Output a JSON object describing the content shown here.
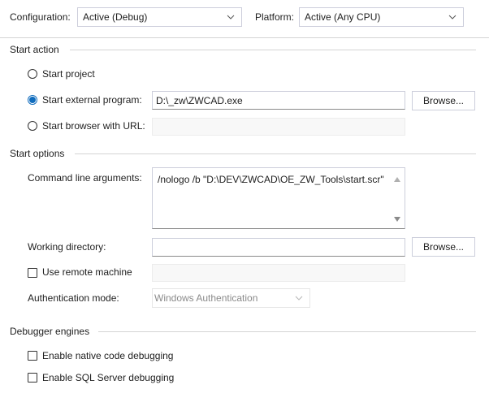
{
  "header": {
    "configuration_label": "Configuration:",
    "configuration_value": "Active (Debug)",
    "platform_label": "Platform:",
    "platform_value": "Active (Any CPU)"
  },
  "start_action": {
    "title": "Start action",
    "start_project_label": "Start project",
    "start_external_label": "Start external program:",
    "start_external_value": "D:\\_zw\\ZWCAD.exe",
    "browse_label": "Browse...",
    "start_browser_label": "Start browser with URL:",
    "selected": "start_external"
  },
  "start_options": {
    "title": "Start options",
    "cmd_args_label": "Command line arguments:",
    "cmd_args_value": "/nologo /b \"D:\\DEV\\ZWCAD\\OE_ZW_Tools\\start.scr\"",
    "working_dir_label": "Working directory:",
    "working_dir_value": "",
    "browse_label": "Browse...",
    "remote_machine_label": "Use remote machine",
    "auth_mode_label": "Authentication mode:",
    "auth_mode_value": "Windows Authentication"
  },
  "debugger_engines": {
    "title": "Debugger engines",
    "native_label": "Enable native code debugging",
    "sql_label": "Enable SQL Server debugging"
  },
  "colors": {
    "accent": "#0f6cbd",
    "border": "#cccedb",
    "separator": "#d4d4d4"
  }
}
